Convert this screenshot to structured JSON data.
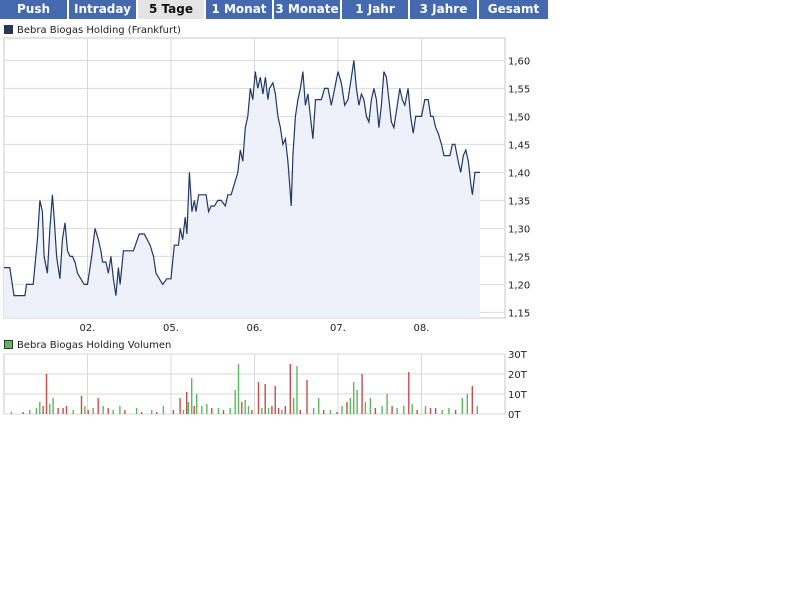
{
  "tabs": [
    {
      "label": "Push",
      "active": false
    },
    {
      "label": "Intraday",
      "active": false
    },
    {
      "label": "5 Tage",
      "active": true
    },
    {
      "label": "1 Monat",
      "active": false
    },
    {
      "label": "3 Monate",
      "active": false
    },
    {
      "label": "1 Jahr",
      "active": false
    },
    {
      "label": "3 Jahre",
      "active": false
    },
    {
      "label": "Gesamt",
      "active": false
    }
  ],
  "colors": {
    "tab_bg": "#4469ae",
    "tab_active_bg": "#e4e4e4",
    "price_line": "#1f3864",
    "price_fill": "#eef1fa",
    "vol_up": "#5cb85c",
    "vol_down": "#c0504d",
    "grid": "#d8d8d8"
  },
  "chart_data": [
    {
      "type": "area",
      "legend": "Bebra Biogas Holding (Frankfurt)",
      "ylim": [
        1.14,
        1.64
      ],
      "yticks": [
        1.15,
        1.2,
        1.25,
        1.3,
        1.35,
        1.4,
        1.45,
        1.5,
        1.55,
        1.6
      ],
      "ytick_labels": [
        "1,15",
        "1,20",
        "1,25",
        "1,30",
        "1,35",
        "1,40",
        "1,45",
        "1,50",
        "1,55",
        "1,60"
      ],
      "xlim": [
        0,
        6
      ],
      "xticks": [
        1,
        2,
        3,
        4,
        5
      ],
      "xtick_labels": [
        "02.",
        "05.",
        "06.",
        "07.",
        "08."
      ],
      "grid": true,
      "series": [
        {
          "name": "Bebra Biogas Holding (Frankfurt)",
          "points": [
            [
              0,
              1.23
            ],
            [
              0.07,
              1.23
            ],
            [
              0.12,
              1.18
            ],
            [
              0.25,
              1.18
            ],
            [
              0.27,
              1.2
            ],
            [
              0.35,
              1.2
            ],
            [
              0.4,
              1.28
            ],
            [
              0.43,
              1.35
            ],
            [
              0.46,
              1.33
            ],
            [
              0.48,
              1.25
            ],
            [
              0.52,
              1.22
            ],
            [
              0.55,
              1.3
            ],
            [
              0.58,
              1.36
            ],
            [
              0.6,
              1.32
            ],
            [
              0.63,
              1.25
            ],
            [
              0.67,
              1.21
            ],
            [
              0.7,
              1.28
            ],
            [
              0.73,
              1.31
            ],
            [
              0.76,
              1.26
            ],
            [
              0.79,
              1.25
            ],
            [
              0.82,
              1.25
            ],
            [
              0.85,
              1.24
            ],
            [
              0.88,
              1.22
            ],
            [
              0.92,
              1.21
            ],
            [
              0.96,
              1.2
            ],
            [
              1.0,
              1.2
            ],
            [
              1.05,
              1.25
            ],
            [
              1.09,
              1.3
            ],
            [
              1.13,
              1.28
            ],
            [
              1.16,
              1.26
            ],
            [
              1.18,
              1.24
            ],
            [
              1.22,
              1.24
            ],
            [
              1.25,
              1.22
            ],
            [
              1.28,
              1.25
            ],
            [
              1.31,
              1.21
            ],
            [
              1.34,
              1.18
            ],
            [
              1.37,
              1.23
            ],
            [
              1.39,
              1.2
            ],
            [
              1.43,
              1.26
            ],
            [
              1.5,
              1.26
            ],
            [
              1.55,
              1.26
            ],
            [
              1.62,
              1.29
            ],
            [
              1.68,
              1.29
            ],
            [
              1.75,
              1.27
            ],
            [
              1.79,
              1.25
            ],
            [
              1.82,
              1.22
            ],
            [
              1.86,
              1.21
            ],
            [
              1.9,
              1.2
            ],
            [
              1.95,
              1.21
            ],
            [
              2.0,
              1.21
            ],
            [
              2.04,
              1.27
            ],
            [
              2.09,
              1.27
            ],
            [
              2.11,
              1.3
            ],
            [
              2.14,
              1.28
            ],
            [
              2.17,
              1.32
            ],
            [
              2.19,
              1.29
            ],
            [
              2.22,
              1.4
            ],
            [
              2.25,
              1.33
            ],
            [
              2.28,
              1.35
            ],
            [
              2.3,
              1.33
            ],
            [
              2.33,
              1.36
            ],
            [
              2.42,
              1.36
            ],
            [
              2.45,
              1.33
            ],
            [
              2.48,
              1.34
            ],
            [
              2.52,
              1.34
            ],
            [
              2.56,
              1.35
            ],
            [
              2.6,
              1.35
            ],
            [
              2.65,
              1.34
            ],
            [
              2.68,
              1.36
            ],
            [
              2.72,
              1.36
            ],
            [
              2.76,
              1.38
            ],
            [
              2.8,
              1.4
            ],
            [
              2.83,
              1.44
            ],
            [
              2.86,
              1.42
            ],
            [
              2.89,
              1.48
            ],
            [
              2.92,
              1.5
            ],
            [
              2.95,
              1.55
            ],
            [
              2.98,
              1.53
            ],
            [
              3.01,
              1.58
            ],
            [
              3.04,
              1.55
            ],
            [
              3.07,
              1.57
            ],
            [
              3.1,
              1.54
            ],
            [
              3.13,
              1.57
            ],
            [
              3.16,
              1.53
            ],
            [
              3.18,
              1.55
            ],
            [
              3.22,
              1.56
            ],
            [
              3.25,
              1.54
            ],
            [
              3.28,
              1.5
            ],
            [
              3.31,
              1.48
            ],
            [
              3.34,
              1.45
            ],
            [
              3.37,
              1.46
            ],
            [
              3.4,
              1.42
            ],
            [
              3.42,
              1.38
            ],
            [
              3.44,
              1.34
            ],
            [
              3.46,
              1.43
            ],
            [
              3.49,
              1.5
            ],
            [
              3.52,
              1.53
            ],
            [
              3.55,
              1.55
            ],
            [
              3.58,
              1.58
            ],
            [
              3.61,
              1.52
            ],
            [
              3.64,
              1.54
            ],
            [
              3.67,
              1.5
            ],
            [
              3.7,
              1.46
            ],
            [
              3.73,
              1.53
            ],
            [
              3.76,
              1.53
            ],
            [
              3.8,
              1.53
            ],
            [
              3.84,
              1.55
            ],
            [
              3.88,
              1.55
            ],
            [
              3.92,
              1.52
            ],
            [
              3.96,
              1.55
            ],
            [
              4.0,
              1.58
            ],
            [
              4.04,
              1.56
            ],
            [
              4.08,
              1.52
            ],
            [
              4.12,
              1.53
            ],
            [
              4.16,
              1.57
            ],
            [
              4.19,
              1.6
            ],
            [
              4.22,
              1.55
            ],
            [
              4.25,
              1.52
            ],
            [
              4.28,
              1.54
            ],
            [
              4.31,
              1.53
            ],
            [
              4.34,
              1.5
            ],
            [
              4.37,
              1.49
            ],
            [
              4.4,
              1.53
            ],
            [
              4.43,
              1.55
            ],
            [
              4.46,
              1.53
            ],
            [
              4.49,
              1.48
            ],
            [
              4.52,
              1.52
            ],
            [
              4.55,
              1.58
            ],
            [
              4.58,
              1.57
            ],
            [
              4.61,
              1.53
            ],
            [
              4.64,
              1.49
            ],
            [
              4.67,
              1.48
            ],
            [
              4.71,
              1.52
            ],
            [
              4.74,
              1.55
            ],
            [
              4.77,
              1.53
            ],
            [
              4.8,
              1.52
            ],
            [
              4.84,
              1.55
            ],
            [
              4.87,
              1.5
            ],
            [
              4.9,
              1.47
            ],
            [
              4.93,
              1.5
            ],
            [
              4.96,
              1.5
            ],
            [
              5.0,
              1.5
            ],
            [
              5.04,
              1.53
            ],
            [
              5.08,
              1.53
            ],
            [
              5.11,
              1.5
            ],
            [
              5.14,
              1.5
            ],
            [
              5.17,
              1.48
            ],
            [
              5.2,
              1.47
            ],
            [
              5.24,
              1.45
            ],
            [
              5.27,
              1.43
            ],
            [
              5.31,
              1.43
            ],
            [
              5.34,
              1.43
            ],
            [
              5.37,
              1.45
            ],
            [
              5.4,
              1.45
            ],
            [
              5.44,
              1.42
            ],
            [
              5.47,
              1.4
            ],
            [
              5.5,
              1.43
            ],
            [
              5.53,
              1.44
            ],
            [
              5.56,
              1.42
            ],
            [
              5.59,
              1.38
            ],
            [
              5.61,
              1.36
            ],
            [
              5.64,
              1.4
            ],
            [
              5.67,
              1.4
            ],
            [
              5.7,
              1.4
            ]
          ]
        }
      ]
    },
    {
      "type": "bar",
      "legend": "Bebra Biogas Holding Volumen",
      "ylim": [
        0,
        30
      ],
      "yticks": [
        0,
        10,
        20,
        30
      ],
      "ytick_labels": [
        "0T",
        "10T",
        "20T",
        "30T"
      ],
      "xlim": [
        0,
        6
      ],
      "bars": [
        [
          0.08,
          1,
          "u"
        ],
        [
          0.22,
          1,
          "d"
        ],
        [
          0.3,
          2,
          "u"
        ],
        [
          0.38,
          3,
          "u"
        ],
        [
          0.42,
          6,
          "u"
        ],
        [
          0.46,
          4,
          "d"
        ],
        [
          0.5,
          20,
          "d"
        ],
        [
          0.54,
          5,
          "u"
        ],
        [
          0.58,
          8,
          "u"
        ],
        [
          0.64,
          3,
          "d"
        ],
        [
          0.7,
          3,
          "d"
        ],
        [
          0.74,
          4,
          "d"
        ],
        [
          0.82,
          2,
          "u"
        ],
        [
          0.92,
          9,
          "d"
        ],
        [
          0.96,
          4,
          "u"
        ],
        [
          1.0,
          2,
          "d"
        ],
        [
          1.06,
          3,
          "u"
        ],
        [
          1.12,
          8,
          "d"
        ],
        [
          1.18,
          4,
          "u"
        ],
        [
          1.24,
          3,
          "d"
        ],
        [
          1.3,
          2,
          "u"
        ],
        [
          1.38,
          4,
          "u"
        ],
        [
          1.44,
          2,
          "d"
        ],
        [
          1.58,
          3,
          "u"
        ],
        [
          1.64,
          1,
          "d"
        ],
        [
          1.76,
          2,
          "u"
        ],
        [
          1.82,
          1,
          "d"
        ],
        [
          1.9,
          4,
          "u"
        ],
        [
          2.02,
          2,
          "d"
        ],
        [
          2.1,
          8,
          "d"
        ],
        [
          2.14,
          2,
          "u"
        ],
        [
          2.18,
          11,
          "d"
        ],
        [
          2.2,
          6,
          "u"
        ],
        [
          2.24,
          18,
          "u"
        ],
        [
          2.27,
          4,
          "d"
        ],
        [
          2.3,
          10,
          "u"
        ],
        [
          2.36,
          4,
          "u"
        ],
        [
          2.42,
          5,
          "u"
        ],
        [
          2.48,
          3,
          "d"
        ],
        [
          2.56,
          3,
          "u"
        ],
        [
          2.62,
          2,
          "d"
        ],
        [
          2.7,
          3,
          "u"
        ],
        [
          2.76,
          12,
          "u"
        ],
        [
          2.8,
          25,
          "u"
        ],
        [
          2.84,
          6,
          "d"
        ],
        [
          2.88,
          7,
          "u"
        ],
        [
          2.92,
          4,
          "u"
        ],
        [
          2.96,
          2,
          "d"
        ],
        [
          3.04,
          16,
          "d"
        ],
        [
          3.08,
          3,
          "u"
        ],
        [
          3.12,
          15,
          "d"
        ],
        [
          3.16,
          3,
          "u"
        ],
        [
          3.2,
          4,
          "d"
        ],
        [
          3.24,
          14,
          "d"
        ],
        [
          3.28,
          3,
          "d"
        ],
        [
          3.32,
          2,
          "u"
        ],
        [
          3.36,
          4,
          "d"
        ],
        [
          3.42,
          25,
          "d"
        ],
        [
          3.46,
          8,
          "u"
        ],
        [
          3.5,
          24,
          "u"
        ],
        [
          3.54,
          2,
          "d"
        ],
        [
          3.62,
          17,
          "d"
        ],
        [
          3.7,
          3,
          "u"
        ],
        [
          3.76,
          8,
          "u"
        ],
        [
          3.82,
          2,
          "d"
        ],
        [
          3.9,
          2,
          "u"
        ],
        [
          3.98,
          1,
          "d"
        ],
        [
          4.04,
          4,
          "u"
        ],
        [
          4.1,
          6,
          "d"
        ],
        [
          4.14,
          8,
          "u"
        ],
        [
          4.18,
          16,
          "u"
        ],
        [
          4.22,
          12,
          "u"
        ],
        [
          4.28,
          20,
          "d"
        ],
        [
          4.32,
          6,
          "u"
        ],
        [
          4.38,
          8,
          "u"
        ],
        [
          4.44,
          3,
          "d"
        ],
        [
          4.52,
          4,
          "u"
        ],
        [
          4.58,
          10,
          "u"
        ],
        [
          4.64,
          4,
          "d"
        ],
        [
          4.7,
          3,
          "u"
        ],
        [
          4.78,
          4,
          "u"
        ],
        [
          4.84,
          21,
          "d"
        ],
        [
          4.88,
          5,
          "u"
        ],
        [
          4.94,
          2,
          "d"
        ],
        [
          5.04,
          4,
          "u"
        ],
        [
          5.1,
          3,
          "d"
        ],
        [
          5.16,
          3,
          "d"
        ],
        [
          5.24,
          2,
          "u"
        ],
        [
          5.32,
          3,
          "u"
        ],
        [
          5.4,
          2,
          "d"
        ],
        [
          5.48,
          8,
          "u"
        ],
        [
          5.54,
          10,
          "u"
        ],
        [
          5.6,
          14,
          "d"
        ],
        [
          5.66,
          4,
          "u"
        ]
      ]
    }
  ]
}
